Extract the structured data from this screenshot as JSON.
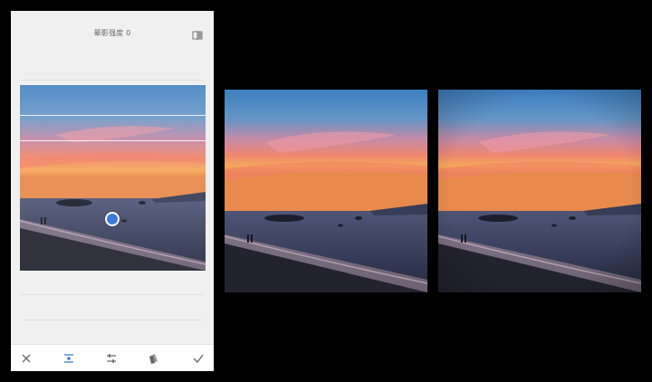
{
  "header": {
    "title": "晕影强度 0",
    "compare_icon": "compare-split-icon"
  },
  "toolbar": {
    "items": [
      {
        "name": "cancel",
        "icon": "close-icon"
      },
      {
        "name": "vignette-placement",
        "icon": "vignette-center-icon",
        "active": true
      },
      {
        "name": "adjust",
        "icon": "sliders-icon"
      },
      {
        "name": "style",
        "icon": "stack-icon"
      },
      {
        "name": "apply",
        "icon": "check-icon"
      }
    ]
  },
  "colors": {
    "accent": "#3c7bdc",
    "panel": "#f0f0f0",
    "background": "#000000"
  }
}
